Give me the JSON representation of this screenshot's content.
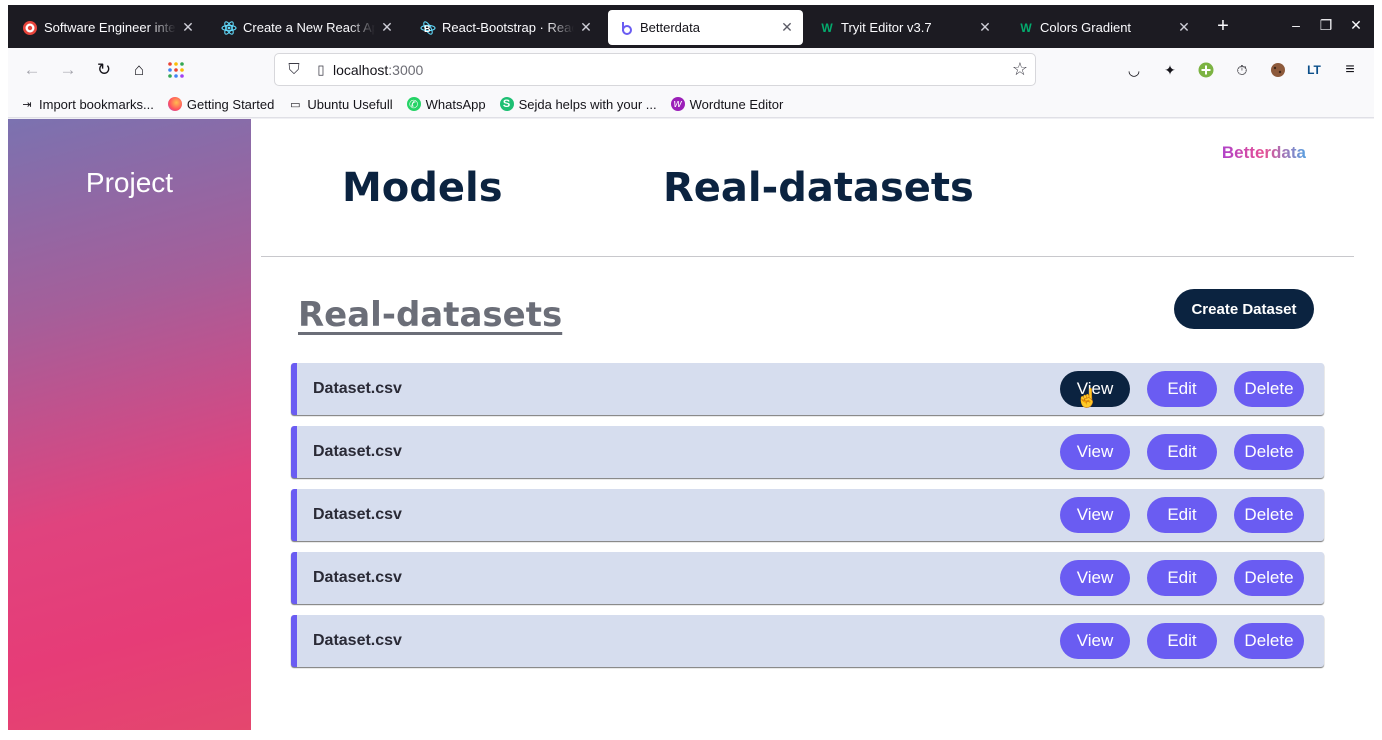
{
  "browser": {
    "tabs": [
      {
        "title": "Software Engineer intern",
        "favicon": "target-icon",
        "active": false
      },
      {
        "title": "Create a New React App",
        "favicon": "react-icon",
        "active": false
      },
      {
        "title": "React-Bootstrap · React",
        "favicon": "react-bootstrap-icon",
        "active": false
      },
      {
        "title": "Betterdata",
        "favicon": "betterdata-icon",
        "active": true
      },
      {
        "title": "Tryit Editor v3.7",
        "favicon": "w3schools-icon",
        "active": false
      },
      {
        "title": "Colors Gradient",
        "favicon": "w3schools-icon",
        "active": false
      }
    ],
    "url_host": "localhost",
    "url_port": ":3000",
    "bookmarks": [
      {
        "label": "Import bookmarks...",
        "icon": "import-icon"
      },
      {
        "label": "Getting Started",
        "icon": "firefox-icon"
      },
      {
        "label": "Ubuntu Usefull",
        "icon": "folder-icon"
      },
      {
        "label": "WhatsApp",
        "icon": "whatsapp-icon"
      },
      {
        "label": "Sejda helps with your ...",
        "icon": "sejda-icon"
      },
      {
        "label": "Wordtune Editor",
        "icon": "wordtune-icon"
      }
    ]
  },
  "sidebar": {
    "title": "Project"
  },
  "header": {
    "brand": "Betterdata",
    "nav": [
      {
        "label": "Models"
      },
      {
        "label": "Real-datasets"
      }
    ]
  },
  "section": {
    "title": "Real-datasets",
    "create_label": "Create Dataset"
  },
  "datasets": [
    {
      "name": "Dataset.csv",
      "view": "View",
      "edit": "Edit",
      "delete": "Delete"
    },
    {
      "name": "Dataset.csv",
      "view": "View",
      "edit": "Edit",
      "delete": "Delete"
    },
    {
      "name": "Dataset.csv",
      "view": "View",
      "edit": "Edit",
      "delete": "Delete"
    },
    {
      "name": "Dataset.csv",
      "view": "View",
      "edit": "Edit",
      "delete": "Delete"
    },
    {
      "name": "Dataset.csv",
      "view": "View",
      "edit": "Edit",
      "delete": "Delete"
    }
  ],
  "colors": {
    "accent": "#6a5cf2",
    "navy": "#0b2340",
    "row_bg": "#d6ddee"
  }
}
